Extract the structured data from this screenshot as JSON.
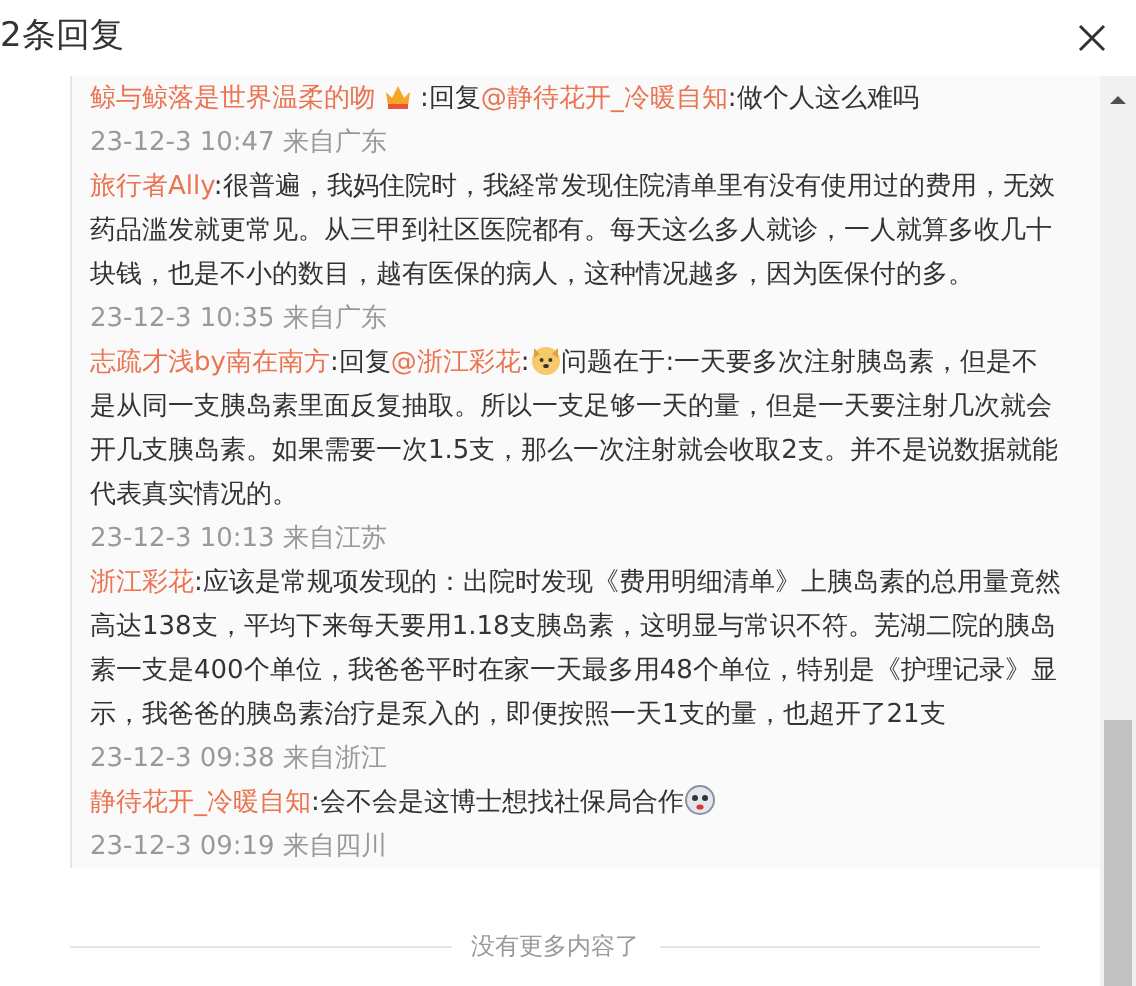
{
  "title": "2条回复",
  "comments": [
    {
      "segments": [
        {
          "kind": "name",
          "text": "鲸与鲸落是世界温柔的吻"
        },
        {
          "kind": "crown"
        },
        {
          "kind": "text",
          "text": ":回复"
        },
        {
          "kind": "name",
          "text": "@静待花开_冷暖自知"
        },
        {
          "kind": "text",
          "text": ":做个人这么难吗"
        }
      ],
      "meta": "23-12-3 10:47 来自广东"
    },
    {
      "segments": [
        {
          "kind": "name",
          "text": "旅行者Ally"
        },
        {
          "kind": "text",
          "text": ":很普遍，我妈住院时，我経常发现住院清单里有没有使用过的费用，无效药品滥发就更常见。从三甲到社区医院都有。每天这么多人就诊，一人就算多收几十块钱，也是不小的数目，越有医保的病人，这种情况越多，因为医保付的多。"
        }
      ],
      "meta": "23-12-3 10:35 来自广东"
    },
    {
      "segments": [
        {
          "kind": "name",
          "text": "志疏才浅by南在南方"
        },
        {
          "kind": "text",
          "text": ":回复"
        },
        {
          "kind": "name",
          "text": "@浙江彩花"
        },
        {
          "kind": "text",
          "text": ":"
        },
        {
          "kind": "dog"
        },
        {
          "kind": "text",
          "text": "问题在于:一天要多次注射胰岛素，但是不是从同一支胰岛素里面反复抽取。所以一支足够一天的量，但是一天要注射几次就会开几支胰岛素。如果需要一次1.5支，那么一次注射就会收取2支。并不是说数据就能代表真实情况的。"
        }
      ],
      "meta": "23-12-3 10:13 来自江苏"
    },
    {
      "segments": [
        {
          "kind": "name",
          "text": "浙江彩花"
        },
        {
          "kind": "text",
          "text": ":应该是常规项发现的：出院时发现《费用明细清单》上胰岛素的总用量竟然高达138支，平均下来每天要用1.18支胰岛素，这明显与常识不符。芜湖二院的胰岛素一支是400个单位，我爸爸平时在家一天最多用48个单位，特别是《护理记录》显示，我爸爸的胰岛素治疗是泵入的，即便按照一天1支的量，也超开了21支"
        }
      ],
      "meta": "23-12-3 09:38 来自浙江"
    },
    {
      "segments": [
        {
          "kind": "name",
          "text": "静待花开_冷暖自知"
        },
        {
          "kind": "text",
          "text": ":会不会是这博士想找社保局合作"
        },
        {
          "kind": "face"
        }
      ],
      "meta": "23-12-3 09:19 来自四川"
    }
  ],
  "footer": "没有更多内容了"
}
